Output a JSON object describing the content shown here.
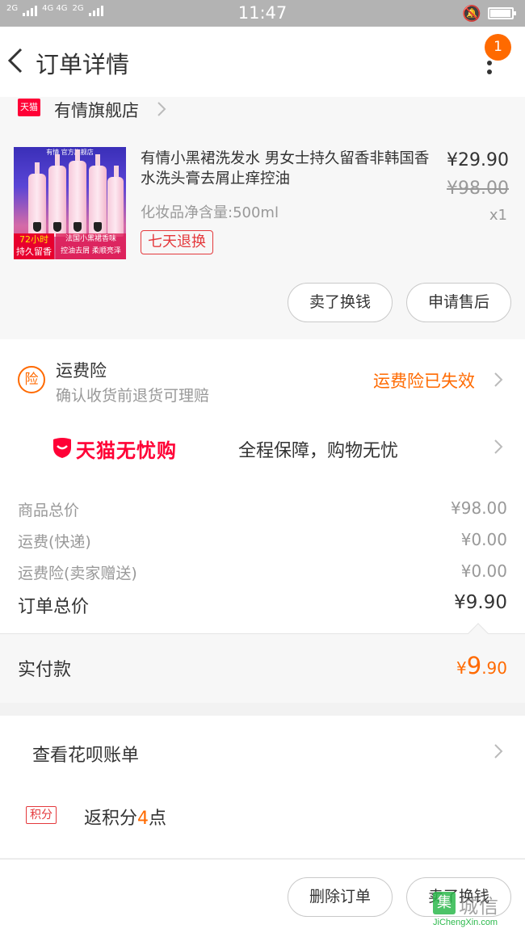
{
  "status_bar": {
    "network_left": "2G",
    "network_mid": "4G 4G",
    "network_mid2": "2G",
    "time": "11:47"
  },
  "header": {
    "title": "订单详情",
    "notification_count": "1"
  },
  "shop": {
    "platform_tag": "天猫",
    "name": "有情旗舰店"
  },
  "product": {
    "title": "有情小黑裙洗发水 男女士持久留香非韩国香水洗头膏去屑止痒控油",
    "spec": "化妆品净含量:500ml",
    "return_policy": "七天退换",
    "price": "¥29.90",
    "original_price": "¥98.00",
    "quantity": "x1",
    "image": {
      "brand_line": "有情 官方旗舰店",
      "badge_line1": "72小时",
      "badge_line2": "持久留香",
      "tag_line1": "法国小黑裙香味",
      "tag_line2": "控油去屑 柔顺亮泽"
    },
    "buttons": {
      "sell": "卖了换钱",
      "after_sale": "申请售后"
    }
  },
  "shipping_insurance": {
    "icon_text": "险",
    "title": "运费险",
    "subtitle": "确认收货前退货可理赔",
    "status": "运费险已失效"
  },
  "wuyou": {
    "brand": "天猫无忧购",
    "slogan": "全程保障，购物无忧"
  },
  "summary": {
    "rows": [
      {
        "label": "商品总价",
        "value": "¥98.00"
      },
      {
        "label": "运费(快递)",
        "value": "¥0.00"
      },
      {
        "label": "运费险(卖家赠送)",
        "value": "¥0.00"
      }
    ],
    "total_label": "订单总价",
    "total_value": "¥9.90"
  },
  "paid": {
    "label": "实付款",
    "currency": "¥",
    "amount_int": "9",
    "amount_dec": ".90"
  },
  "extra": {
    "huabei_label": "查看花呗账单",
    "points_tag": "积分",
    "points_prefix": "返积分",
    "points_value": "4",
    "points_suffix": "点"
  },
  "footer": {
    "delete_label": "删除订单",
    "sell_label": "卖了换钱"
  },
  "watermark": {
    "logo": "集",
    "cn": "城信",
    "en": "JiChengXin.com"
  },
  "colors": {
    "accent_orange": "#ff6a00",
    "tmall_red": "#ff0036",
    "tag_red": "#e4393c"
  }
}
